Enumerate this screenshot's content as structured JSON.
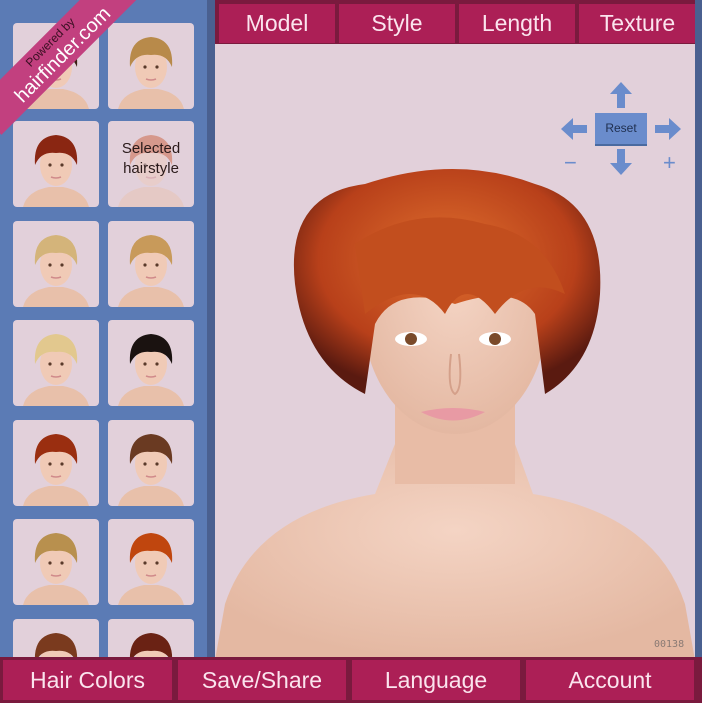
{
  "branding": {
    "line1": "Powered by",
    "line2": "hairfinder.com"
  },
  "top_tabs": [
    "Model",
    "Style",
    "Length",
    "Texture"
  ],
  "bottom_tabs": [
    "Hair Colors",
    "Save/Share",
    "Language",
    "Account"
  ],
  "controls": {
    "reset_label": "Reset",
    "zoom_out_symbol": "−",
    "zoom_in_symbol": "+",
    "icons": [
      "arrow-up-icon",
      "arrow-down-icon",
      "arrow-left-icon",
      "arrow-right-icon"
    ]
  },
  "selected_label": "Selected hairstyle",
  "image_code": "00138",
  "colors": {
    "accent": "#ac1f56",
    "sidebar": "#5b7bb5",
    "canvas": "#e2d0da",
    "control": "#6a8ccc",
    "ribbon": "#c2407f"
  },
  "hairstyles": [
    {
      "name": "dark-wavy-long",
      "hair": "#3a1f14"
    },
    {
      "name": "blonde-quiff-short",
      "hair": "#b88a4a"
    },
    {
      "name": "red-bob-bangs",
      "hair": "#8a2612"
    },
    {
      "name": "selected",
      "hair": "#c8562e"
    },
    {
      "name": "blonde-pixie",
      "hair": "#d4b47a"
    },
    {
      "name": "blonde-bob-sidepart",
      "hair": "#c89a5a"
    },
    {
      "name": "blonde-asymmetric",
      "hair": "#e2c88e"
    },
    {
      "name": "black-sweep",
      "hair": "#1a1210"
    },
    {
      "name": "red-side-swept",
      "hair": "#9a2e10"
    },
    {
      "name": "brown-curly",
      "hair": "#6a3a22"
    },
    {
      "name": "honey-layered",
      "hair": "#b8904e"
    },
    {
      "name": "copper-wavy-short",
      "hair": "#c0460e"
    },
    {
      "name": "auburn-curly",
      "hair": "#7a3a1e"
    },
    {
      "name": "auburn-long",
      "hair": "#6a2214"
    }
  ]
}
